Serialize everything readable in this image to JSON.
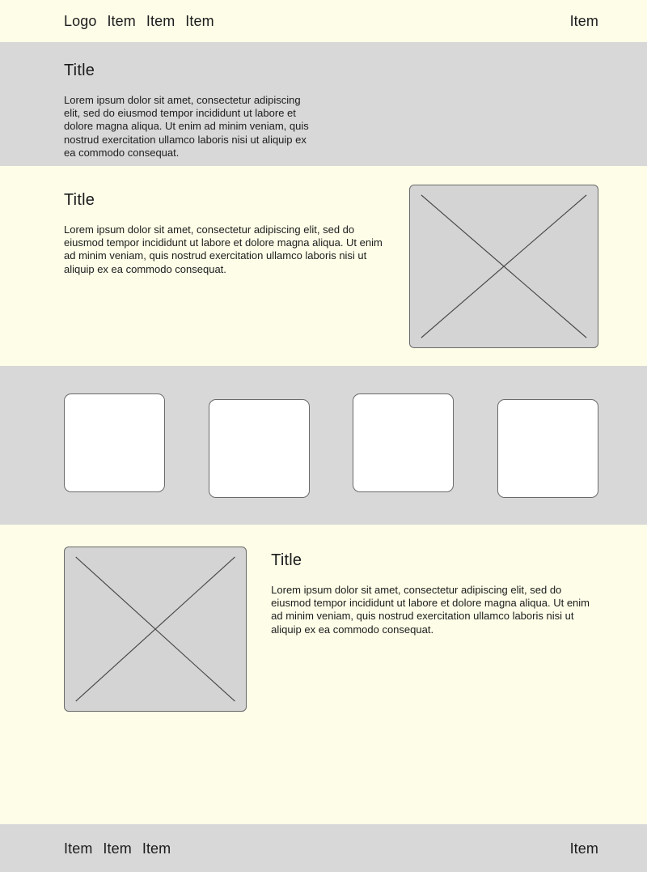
{
  "colors": {
    "background_cream": "#fdfde8",
    "band_gray": "#d8d8d8",
    "placeholder_fill": "#d4d4d4",
    "card_fill": "#ffffff",
    "stroke": "#6a6a6a",
    "text": "#1c1c1c"
  },
  "header": {
    "logo": "Logo",
    "nav_items": [
      "Item",
      "Item",
      "Item"
    ],
    "right_item": "Item"
  },
  "sections": {
    "intro": {
      "title": "Title",
      "body": "Lorem ipsum dolor sit amet, consectetur adipiscing elit, sed do eiusmod tempor incididunt ut labore et dolore magna aliqua. Ut enim ad minim veniam, quis nostrud exercitation ullamco laboris nisi ut aliquip ex ea commodo consequat."
    },
    "media_right": {
      "title": "Title",
      "body": "Lorem ipsum dolor sit amet, consectetur adipiscing elit, sed do eiusmod tempor incididunt ut labore et dolore magna aliqua. Ut enim ad minim veniam, quis nostrud exercitation ullamco laboris nisi ut aliquip ex ea commodo consequat.",
      "image_alt": "image-placeholder"
    },
    "cards": {
      "items": [
        {
          "label": ""
        },
        {
          "label": ""
        },
        {
          "label": ""
        },
        {
          "label": ""
        }
      ]
    },
    "media_left": {
      "title": "Title",
      "body": "Lorem ipsum dolor sit amet, consectetur adipiscing elit, sed do eiusmod tempor incididunt ut labore et dolore magna aliqua. Ut enim ad minim veniam, quis nostrud exercitation ullamco laboris nisi ut aliquip ex ea commodo consequat.",
      "image_alt": "image-placeholder"
    }
  },
  "footer": {
    "nav_items": [
      "Item",
      "Item",
      "Item"
    ],
    "right_item": "Item"
  }
}
